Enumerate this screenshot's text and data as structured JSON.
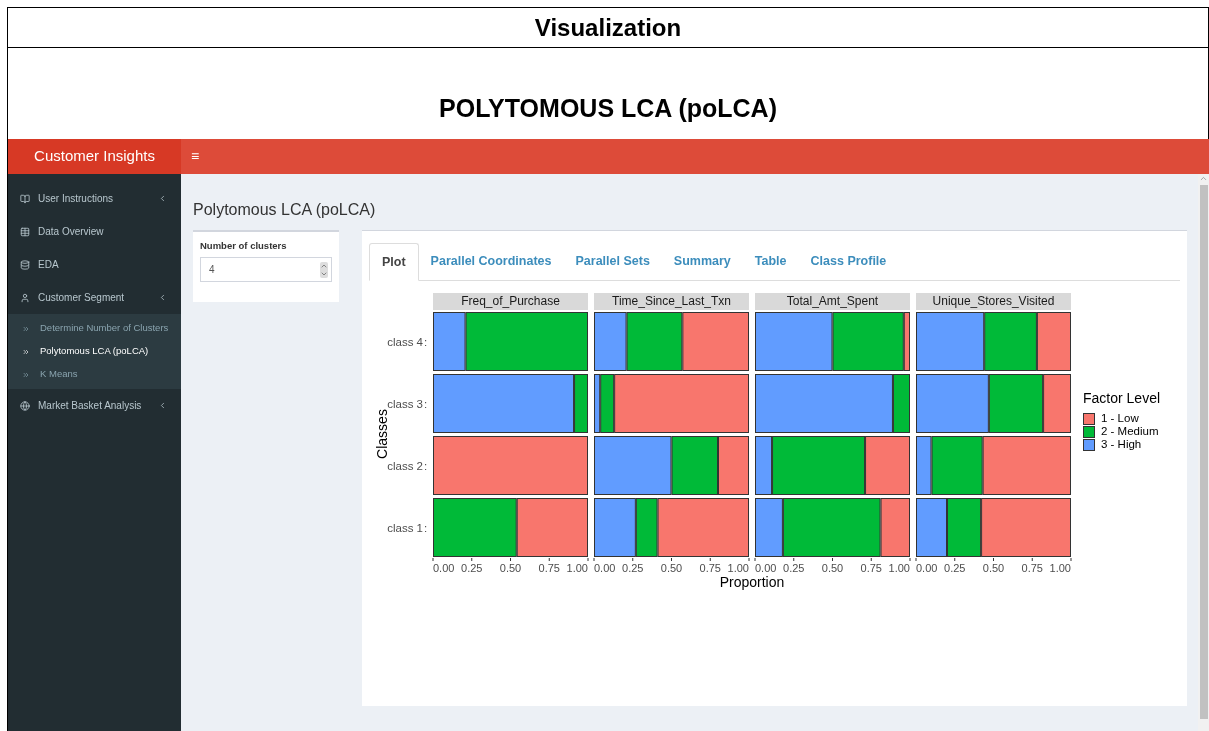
{
  "page_header": {
    "title": "Visualization",
    "subtitle": "POLYTOMOUS LCA (poLCA)"
  },
  "app": {
    "brand": "Customer Insights",
    "menu_toggle": "≡",
    "sidebar": [
      {
        "label": "User Instructions",
        "expandable": true
      },
      {
        "label": "Data Overview",
        "expandable": false
      },
      {
        "label": "EDA",
        "expandable": false
      },
      {
        "label": "Customer Segment",
        "expandable": true,
        "children": [
          {
            "label": "Determine Number of Clusters",
            "selected": false
          },
          {
            "label": "Polytomous LCA (poLCA)",
            "selected": true
          },
          {
            "label": "K Means",
            "selected": false
          }
        ]
      },
      {
        "label": "Market Basket Analysis",
        "expandable": true
      }
    ],
    "page_title": "Polytomous LCA (poLCA)",
    "input": {
      "label": "Number of clusters",
      "value": "4"
    },
    "tabs": [
      {
        "label": "Plot",
        "selected": true
      },
      {
        "label": "Parallel Coordinates",
        "selected": false
      },
      {
        "label": "Parallel Sets",
        "selected": false
      },
      {
        "label": "Summary",
        "selected": false
      },
      {
        "label": "Table",
        "selected": false
      },
      {
        "label": "Class Profile",
        "selected": false
      }
    ],
    "plot": {
      "xlabel": "Proportion",
      "legend_title": "Factor Level",
      "category_separator": ":",
      "facets": [
        {
          "chart_data": {
            "type": "bar",
            "orientation": "horizontal",
            "stacked": true,
            "title": "Freq_of_Purchase",
            "ylabel": "Classes",
            "categories": [
              "class 4",
              "class 3",
              "class 2",
              "class 1"
            ],
            "xlim": [
              0,
              1
            ],
            "xticks": [
              {
                "value": 0,
                "label": "0.00"
              },
              {
                "value": 0.25,
                "label": "0.25"
              },
              {
                "value": 0.5,
                "label": "0.50"
              },
              {
                "value": 0.75,
                "label": "0.75"
              },
              {
                "value": 1,
                "label": "1.00"
              }
            ],
            "series": [
              {
                "name": "1 - Low",
                "color": "#f8766d",
                "values": [
                  0,
                  0,
                  1,
                  0.46
                ]
              },
              {
                "name": "2 - Medium",
                "color": "#00ba38",
                "values": [
                  0.79,
                  0.09,
                  0,
                  0.54
                ]
              },
              {
                "name": "3 - High",
                "color": "#619cff",
                "values": [
                  0.21,
                  0.91,
                  0,
                  0
                ]
              }
            ]
          }
        },
        {
          "chart_data": {
            "type": "bar",
            "orientation": "horizontal",
            "stacked": true,
            "title": "Time_Since_Last_Txn",
            "xlim": [
              0,
              1
            ],
            "xticks": [
              {
                "value": 0,
                "label": "0.00"
              },
              {
                "value": 0.25,
                "label": "0.25"
              },
              {
                "value": 0.5,
                "label": "0.50"
              },
              {
                "value": 0.75,
                "label": "0.75"
              },
              {
                "value": 1,
                "label": "1.00"
              }
            ],
            "series": [
              {
                "color": "#f8766d",
                "values": [
                  0.43,
                  0.87,
                  0.2,
                  0.59
                ]
              },
              {
                "color": "#00ba38",
                "values": [
                  0.36,
                  0.09,
                  0.3,
                  0.14
                ]
              },
              {
                "color": "#619cff",
                "values": [
                  0.21,
                  0.04,
                  0.5,
                  0.27
                ]
              }
            ]
          }
        },
        {
          "chart_data": {
            "type": "bar",
            "orientation": "horizontal",
            "stacked": true,
            "title": "Total_Amt_Spent",
            "xlim": [
              0,
              1
            ],
            "xticks": [
              {
                "value": 0,
                "label": "0.00"
              },
              {
                "value": 0.25,
                "label": "0.25"
              },
              {
                "value": 0.5,
                "label": "0.50"
              },
              {
                "value": 0.75,
                "label": "0.75"
              },
              {
                "value": 1,
                "label": "1.00"
              }
            ],
            "series": [
              {
                "color": "#f8766d",
                "values": [
                  0.04,
                  0,
                  0.29,
                  0.19
                ]
              },
              {
                "color": "#00ba38",
                "values": [
                  0.46,
                  0.11,
                  0.6,
                  0.63
                ]
              },
              {
                "color": "#619cff",
                "values": [
                  0.5,
                  0.89,
                  0.11,
                  0.18
                ]
              }
            ]
          }
        },
        {
          "chart_data": {
            "type": "bar",
            "orientation": "horizontal",
            "stacked": true,
            "title": "Unique_Stores_Visited",
            "xlim": [
              0,
              1
            ],
            "xticks": [
              {
                "value": 0,
                "label": "0.00"
              },
              {
                "value": 0.25,
                "label": "0.25"
              },
              {
                "value": 0.5,
                "label": "0.50"
              },
              {
                "value": 0.75,
                "label": "0.75"
              },
              {
                "value": 1,
                "label": "1.00"
              }
            ],
            "series": [
              {
                "color": "#f8766d",
                "values": [
                  0.22,
                  0.18,
                  0.57,
                  0.58
                ]
              },
              {
                "color": "#00ba38",
                "values": [
                  0.34,
                  0.35,
                  0.33,
                  0.22
                ]
              },
              {
                "color": "#619cff",
                "values": [
                  0.44,
                  0.47,
                  0.1,
                  0.2
                ]
              }
            ]
          }
        }
      ]
    }
  }
}
